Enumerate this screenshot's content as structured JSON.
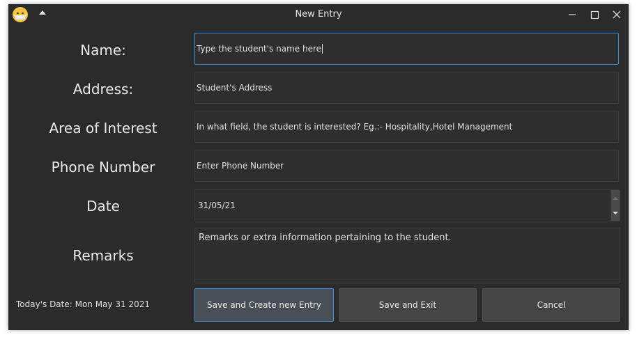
{
  "window": {
    "title": "New Entry"
  },
  "labels": {
    "name": "Name:",
    "address": "Address:",
    "interest": "Area of Interest",
    "phone": "Phone Number",
    "date": "Date",
    "remarks": "Remarks"
  },
  "fields": {
    "name_value": "Type the student's name here",
    "address_placeholder": "Student's Address",
    "interest_placeholder": "In what field,  the student is interested? Eg.:- Hospitality,Hotel Management",
    "phone_placeholder": "Enter Phone Number",
    "date_value": "31/05/21",
    "remarks_value": "Remarks or extra information pertaining to the student."
  },
  "status": {
    "today": "Today's Date: Mon May 31 2021"
  },
  "buttons": {
    "save_new": "Save and Create new Entry",
    "save_exit": "Save and Exit",
    "cancel": "Cancel"
  },
  "colors": {
    "accent": "#3d8ee0",
    "background": "#2b2b2b"
  },
  "icons": [
    "app-icon",
    "menu-arrow-icon",
    "minimize-icon",
    "maximize-icon",
    "close-icon"
  ]
}
